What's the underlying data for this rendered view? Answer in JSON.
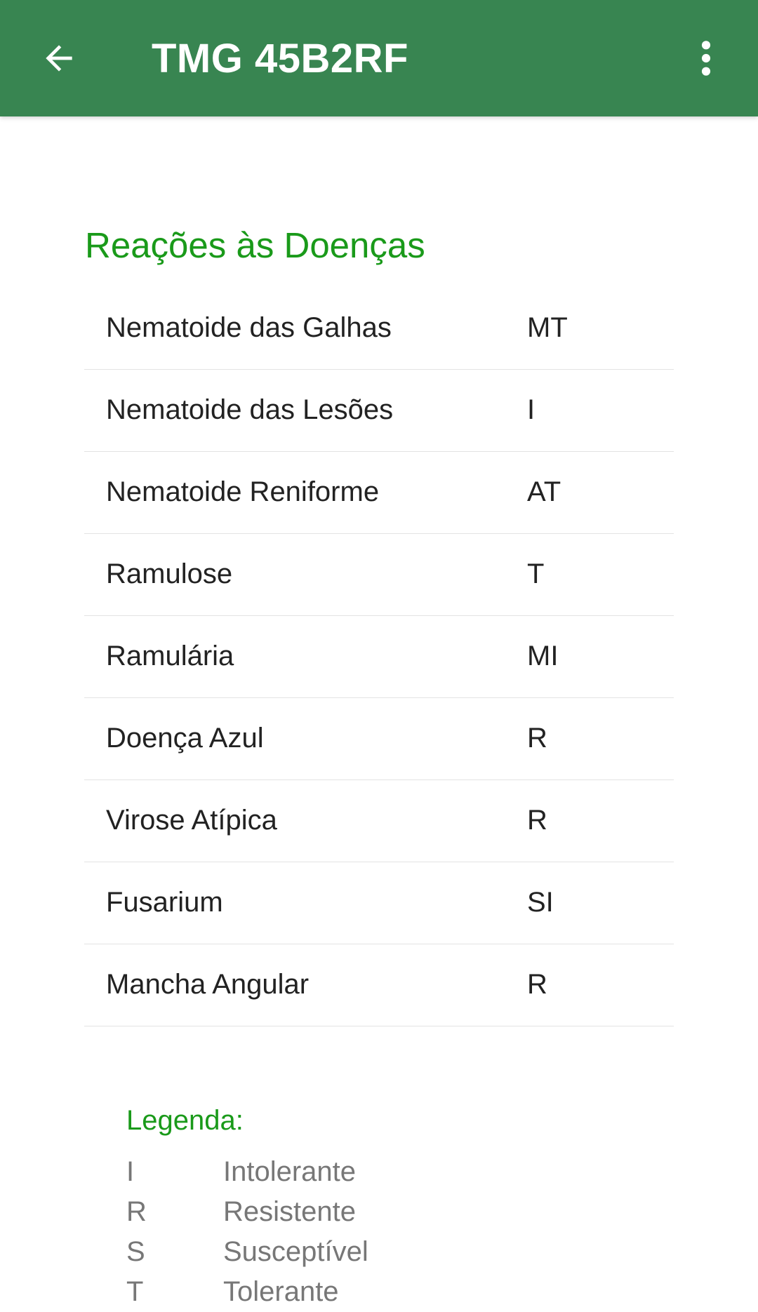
{
  "app_bar": {
    "title": "TMG 45B2RF",
    "back_icon": "arrow-left-icon",
    "menu_icon": "more-vertical-icon",
    "color": "#388551"
  },
  "section": {
    "title": "Reações às Doenças",
    "color": "#1a9a1a"
  },
  "diseases": [
    {
      "name": "Nematoide das Galhas",
      "value": "MT"
    },
    {
      "name": "Nematoide das Lesões",
      "value": "I"
    },
    {
      "name": "Nematoide Reniforme",
      "value": "AT"
    },
    {
      "name": "Ramulose",
      "value": "T"
    },
    {
      "name": "Ramulária",
      "value": "MI"
    },
    {
      "name": "Doença Azul",
      "value": "R"
    },
    {
      "name": "Virose Atípica",
      "value": "R"
    },
    {
      "name": "Fusarium",
      "value": "SI"
    },
    {
      "name": "Mancha Angular",
      "value": "R"
    }
  ],
  "legend": {
    "title": "Legenda:",
    "items": [
      {
        "code": "I",
        "description": "Intolerante"
      },
      {
        "code": "R",
        "description": "Resistente"
      },
      {
        "code": "S",
        "description": "Susceptível"
      },
      {
        "code": "T",
        "description": "Tolerante"
      }
    ]
  }
}
